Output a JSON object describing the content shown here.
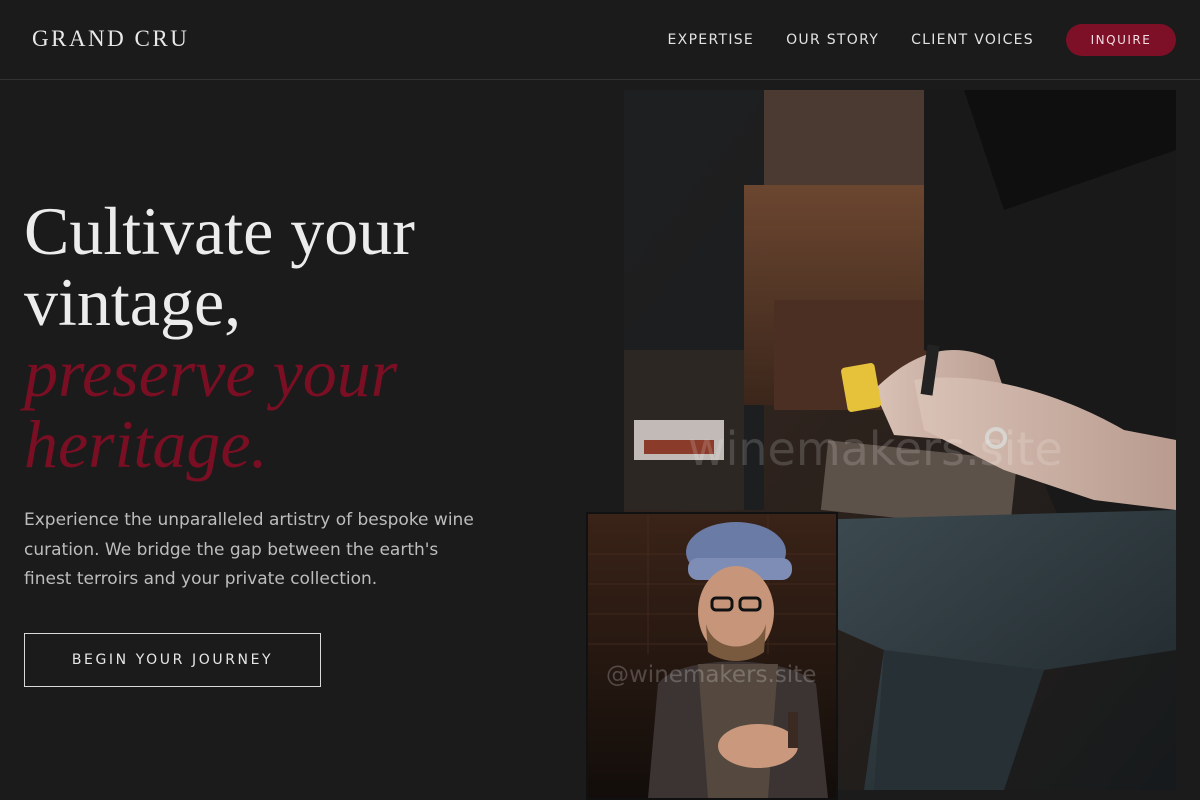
{
  "header": {
    "brand": "GRAND CRU",
    "nav": [
      {
        "label": "EXPERTISE"
      },
      {
        "label": "OUR STORY"
      },
      {
        "label": "CLIENT VOICES"
      }
    ],
    "inquire_label": "INQUIRE"
  },
  "hero": {
    "title_line1": "Cultivate your",
    "title_line2": "vintage,",
    "accent_line1": "preserve your",
    "accent_line2": "heritage.",
    "description": "Experience the unparalleled artistry of bespoke wine curation. We bridge the gap between the earth's finest terroirs and your private collection.",
    "cta_label": "BEGIN YOUR JOURNEY"
  },
  "images": {
    "main_watermark": "winemakers.site",
    "small_watermark": "@winemakers.site"
  },
  "colors": {
    "background": "#1b1b1b",
    "accent": "#7d0f26",
    "text": "#ececec"
  }
}
